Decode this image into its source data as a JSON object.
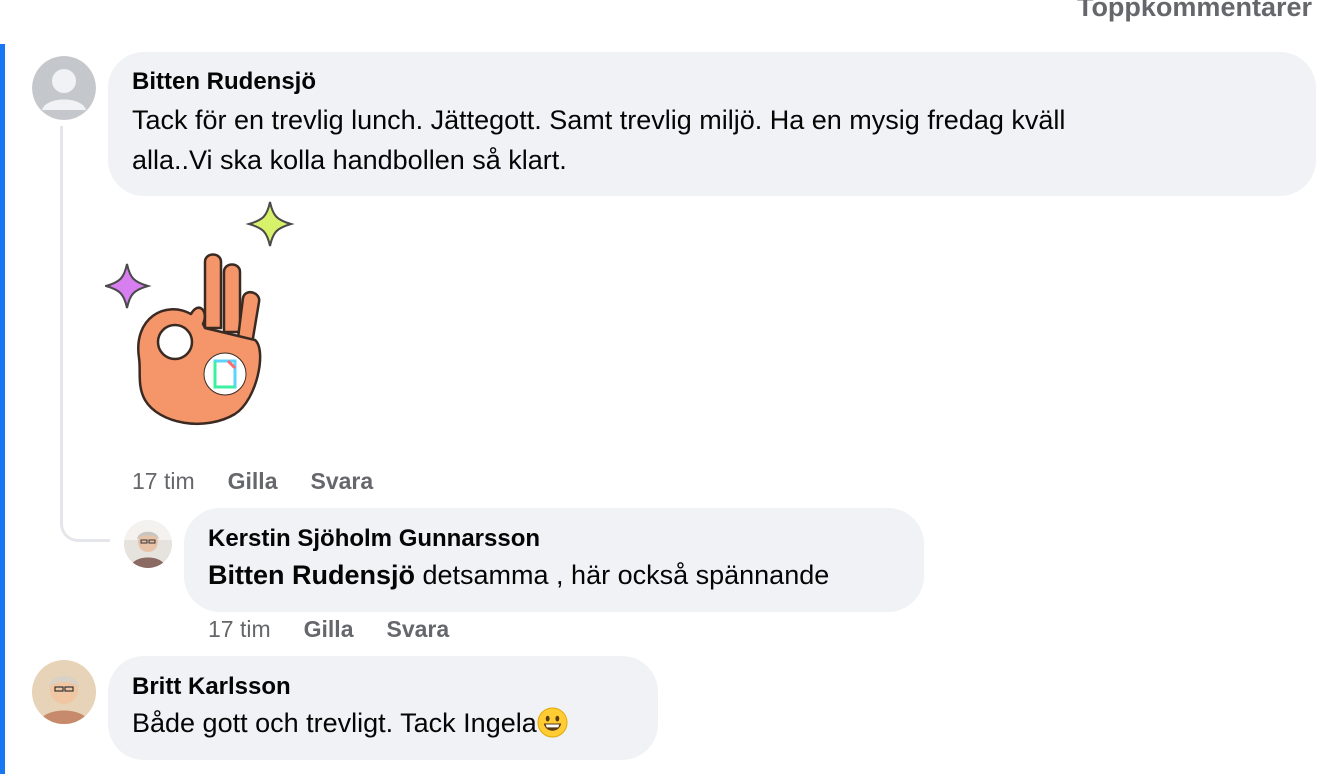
{
  "header": {
    "sort_label": "Toppkommentarer"
  },
  "comments": [
    {
      "author": "Bitten Rudensjö",
      "text_line1": "Tack för en trevlig lunch. Jättegott. Samt trevlig miljö. Ha en mysig fredag kväll",
      "text_line2": "alla..Vi ska kolla handbollen så klart.",
      "sticker": "ok-hand-sticker",
      "time": "17 tim",
      "like_label": "Gilla",
      "reply_label": "Svara"
    },
    {
      "author": "Kerstin Sjöholm Gunnarsson",
      "mention": "Bitten Rudensjö",
      "text": " detsamma , här också spännande",
      "time": "17 tim",
      "like_label": "Gilla",
      "reply_label": "Svara"
    },
    {
      "author": "Britt Karlsson",
      "text": "Både gott och trevligt. Tack Ingela",
      "emoji": "grinning-face"
    }
  ],
  "colors": {
    "accent": "#1877f2",
    "bubble": "#f0f2f5",
    "meta": "#65676b"
  }
}
